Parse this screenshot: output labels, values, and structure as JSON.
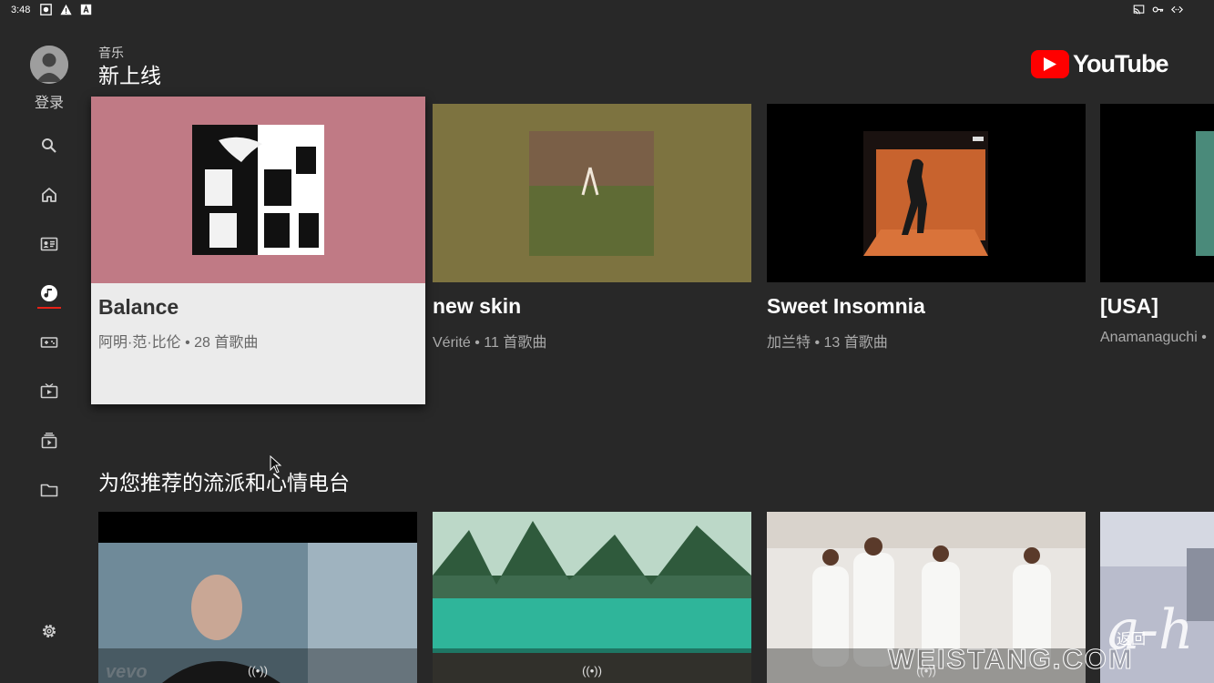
{
  "status_bar": {
    "time": "3:48",
    "left_icons": [
      "screenshot-icon",
      "warning-icon",
      "a-badge-icon"
    ],
    "right_icons": [
      "cast-icon",
      "vpn-key-icon",
      "code-icon"
    ]
  },
  "sidebar": {
    "login_label": "登录",
    "items": [
      {
        "icon": "search-icon"
      },
      {
        "icon": "home-icon"
      },
      {
        "icon": "subscriptions-icon"
      },
      {
        "icon": "music-icon",
        "active": true
      },
      {
        "icon": "gaming-icon"
      },
      {
        "icon": "tv-icon"
      },
      {
        "icon": "queue-icon"
      },
      {
        "icon": "folder-icon"
      },
      {
        "icon": "settings-icon"
      }
    ]
  },
  "header": {
    "kicker": "音乐",
    "title": "新上线",
    "logo_text": "YouTube"
  },
  "albums": [
    {
      "title": "Balance",
      "subtitle": "阿明·范·比伦 • 28 首歌曲",
      "bg": "#c07a85",
      "focused": true
    },
    {
      "title": "new skin",
      "subtitle": "Vérité • 11 首歌曲",
      "bg": "#7d7340"
    },
    {
      "title": "Sweet Insomnia",
      "subtitle": "加兰特 • 13 首歌曲",
      "bg": "#000000"
    },
    {
      "title": "[USA]",
      "subtitle": "Anamanaguchi •",
      "bg": "#000000"
    }
  ],
  "radio_row": {
    "title": "为您推荐的流派和心情电台",
    "badge": "((•))"
  },
  "overlay": {
    "watermark": "WEISTANG.COM",
    "back_label": "返回"
  }
}
